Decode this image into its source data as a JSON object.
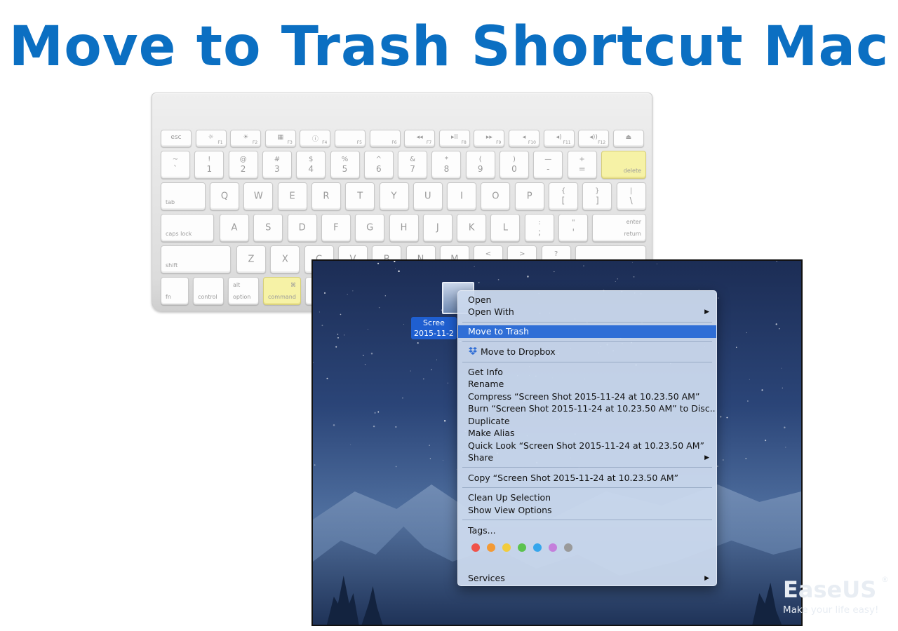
{
  "headline": "Move to Trash Shortcut Mac",
  "keyboard": {
    "fn_row": [
      {
        "main": "esc"
      },
      {
        "main": "☼",
        "sub": "F1"
      },
      {
        "main": "☀",
        "sub": "F2"
      },
      {
        "main": "▦",
        "sub": "F3"
      },
      {
        "main": "ⓘ",
        "sub": "F4"
      },
      {
        "main": "",
        "sub": "F5"
      },
      {
        "main": "",
        "sub": "F6"
      },
      {
        "main": "◂◂",
        "sub": "F7"
      },
      {
        "main": "▸ll",
        "sub": "F8"
      },
      {
        "main": "▸▸",
        "sub": "F9"
      },
      {
        "main": "◂",
        "sub": "F10"
      },
      {
        "main": "◂)",
        "sub": "F11"
      },
      {
        "main": "◂))",
        "sub": "F12"
      },
      {
        "main": "⏏"
      }
    ],
    "num_row": [
      {
        "top": "~",
        "bottom": "`"
      },
      {
        "top": "!",
        "bottom": "1"
      },
      {
        "top": "@",
        "bottom": "2"
      },
      {
        "top": "#",
        "bottom": "3"
      },
      {
        "top": "$",
        "bottom": "4"
      },
      {
        "top": "%",
        "bottom": "5"
      },
      {
        "top": "^",
        "bottom": "6"
      },
      {
        "top": "&",
        "bottom": "7"
      },
      {
        "top": "*",
        "bottom": "8"
      },
      {
        "top": "(",
        "bottom": "9"
      },
      {
        "top": ")",
        "bottom": "0"
      },
      {
        "top": "—",
        "bottom": "-"
      },
      {
        "top": "+",
        "bottom": "="
      }
    ],
    "delete_label": "delete",
    "tab_label": "tab",
    "qwerty_row": [
      "Q",
      "W",
      "E",
      "R",
      "T",
      "Y",
      "U",
      "I",
      "O",
      "P"
    ],
    "bracket_keys": [
      {
        "top": "{",
        "bottom": "["
      },
      {
        "top": "}",
        "bottom": "]"
      },
      {
        "top": "|",
        "bottom": "\\"
      }
    ],
    "caps_label": "caps lock",
    "home_row": [
      "A",
      "S",
      "D",
      "F",
      "G",
      "H",
      "J",
      "K",
      "L"
    ],
    "home_punct": [
      {
        "top": ":",
        "bottom": ";"
      },
      {
        "top": "\"",
        "bottom": "'"
      }
    ],
    "enter_label": "enter",
    "return_label": "return",
    "shift_label": "shift",
    "bottom_letters": [
      "Z",
      "X",
      "C",
      "V",
      "B",
      "N",
      "M"
    ],
    "bottom_punct": [
      {
        "top": "<",
        "bottom": ""
      },
      {
        "top": ">",
        "bottom": ""
      },
      {
        "top": "?",
        "bottom": ""
      }
    ],
    "fn_label": "fn",
    "control_label": "control",
    "alt_label": "alt",
    "option_label": "option",
    "command_symbol": "⌘",
    "command_label": "command"
  },
  "desktop": {
    "file_label": "Scree\n2015-11-2"
  },
  "menu": {
    "open": "Open",
    "open_with": "Open With",
    "move_to_trash": "Move to Trash",
    "move_to_dropbox": "Move to Dropbox",
    "get_info": "Get Info",
    "rename": "Rename",
    "compress": "Compress “Screen Shot 2015-11-24 at 10.23.50 AM”",
    "burn": "Burn “Screen Shot 2015-11-24 at 10.23.50 AM” to Disc...",
    "duplicate": "Duplicate",
    "make_alias": "Make Alias",
    "quick_look": "Quick Look “Screen Shot 2015-11-24 at 10.23.50 AM”",
    "share": "Share",
    "copy": "Copy “Screen Shot 2015-11-24 at 10.23.50 AM”",
    "clean_up": "Clean Up Selection",
    "show_view_options": "Show View Options",
    "tags": "Tags...",
    "services": "Services",
    "submenu_arrow": "▶",
    "tag_colors": [
      "#f0524a",
      "#f39a35",
      "#f2cc3c",
      "#5cc24e",
      "#36a6ec",
      "#c47fdb",
      "#9a9a9a"
    ]
  },
  "logo": {
    "name": "EaseUS",
    "registered": "®",
    "tagline": "Make your life easy!"
  }
}
